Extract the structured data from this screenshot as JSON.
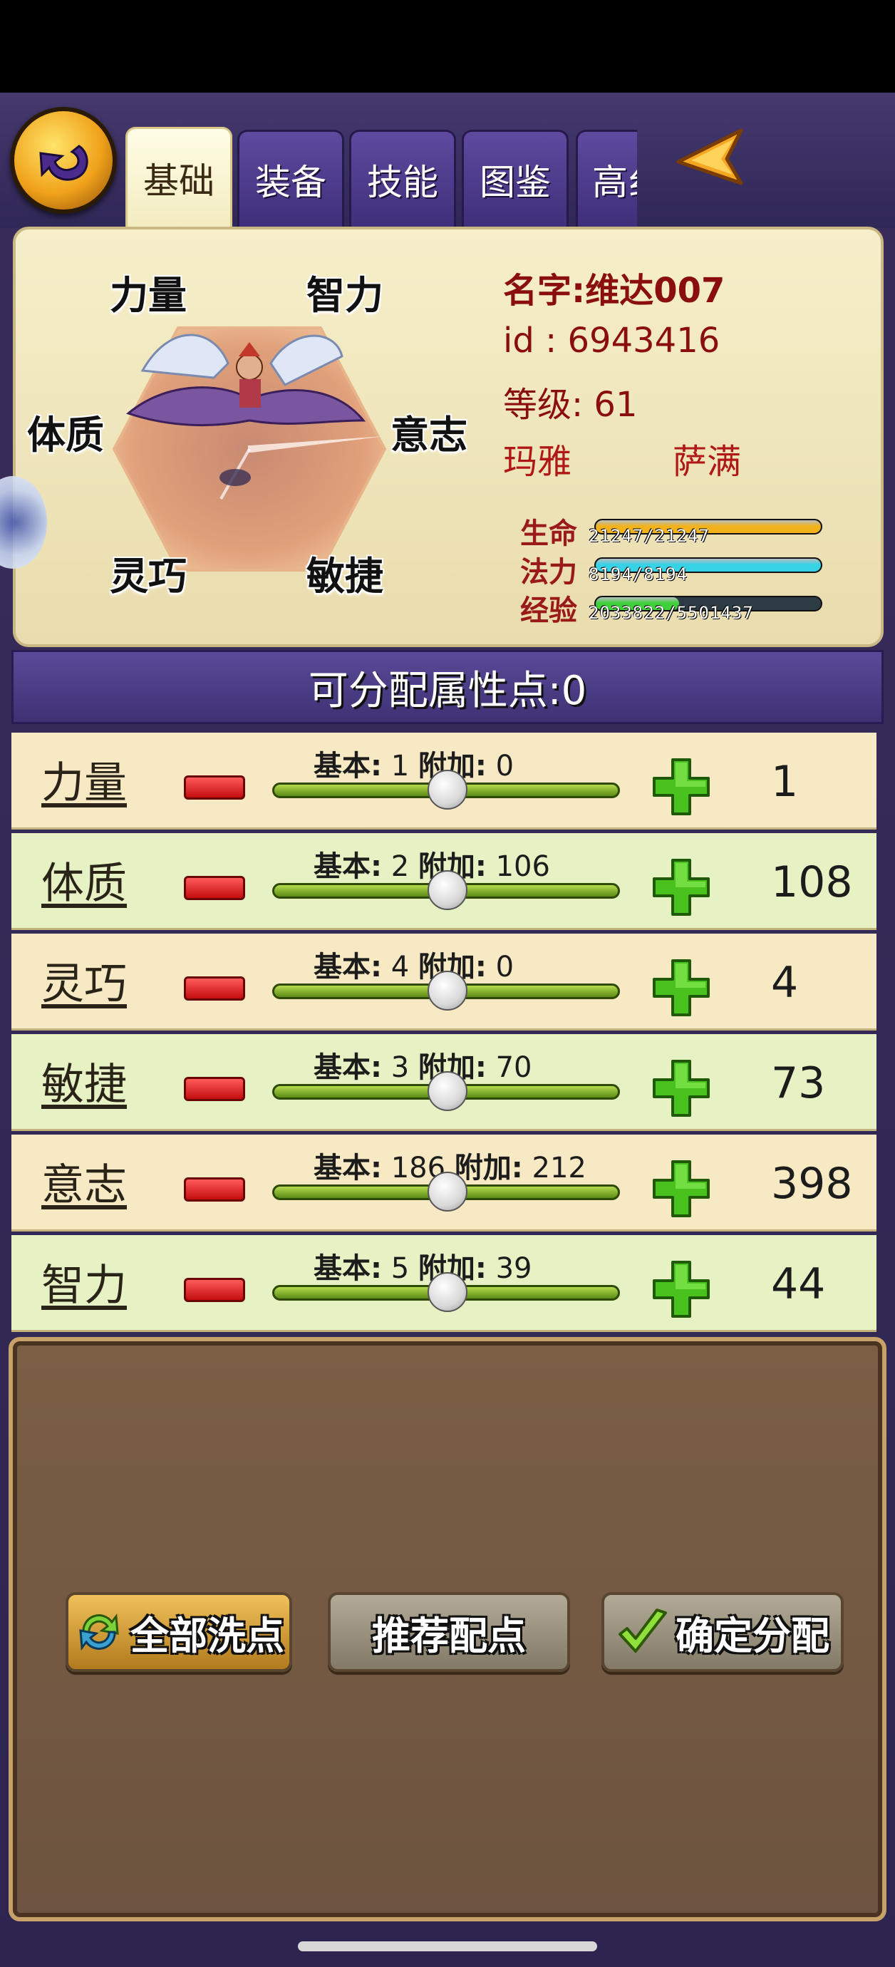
{
  "tabs": [
    {
      "label": "基础",
      "active": true
    },
    {
      "label": "装备",
      "active": false
    },
    {
      "label": "技能",
      "active": false
    },
    {
      "label": "图鉴",
      "active": false
    },
    {
      "label": "高纟",
      "active": false
    }
  ],
  "hex_labels": {
    "strength": "力量",
    "intelligence": "智力",
    "constitution": "体质",
    "will": "意志",
    "dexterity": "灵巧",
    "agility": "敏捷"
  },
  "character": {
    "name": "名字:维达007",
    "id": "id : 6943416",
    "level": "等级: 61",
    "race": "玛雅",
    "class": "萨满"
  },
  "bars": [
    {
      "label": "生命",
      "text": "21247/21247",
      "fill": 1.0,
      "color": "#f2b21c"
    },
    {
      "label": "法力",
      "text": "8194/8194",
      "fill": 1.0,
      "color": "#36d2e6"
    },
    {
      "label": "经验",
      "text": "2033822/5501437",
      "fill": 0.37,
      "color": "#3fd13c"
    }
  ],
  "points": "可分配属性点:0",
  "stats": [
    {
      "name": "力量",
      "base_label": "基本:",
      "base": "1",
      "bonus_label": "附加:",
      "bonus": "0",
      "total": "1"
    },
    {
      "name": "体质",
      "base_label": "基本:",
      "base": "2",
      "bonus_label": "附加:",
      "bonus": "106",
      "total": "108"
    },
    {
      "name": "灵巧",
      "base_label": "基本:",
      "base": "4",
      "bonus_label": "附加:",
      "bonus": "0",
      "total": "4"
    },
    {
      "name": "敏捷",
      "base_label": "基本:",
      "base": "3",
      "bonus_label": "附加:",
      "bonus": "70",
      "total": "73"
    },
    {
      "name": "意志",
      "base_label": "基本:",
      "base": "186",
      "bonus_label": "附加:",
      "bonus": "212",
      "total": "398"
    },
    {
      "name": "智力",
      "base_label": "基本:",
      "base": "5",
      "bonus_label": "附加:",
      "bonus": "39",
      "total": "44"
    }
  ],
  "actions": {
    "reset": "全部洗点",
    "recommend": "推荐配点",
    "confirm": "确定分配"
  },
  "colors": {
    "row_light": "#f7e9c4",
    "row_green": "#e6f1c4",
    "accent_red": "#8a0e0e"
  }
}
